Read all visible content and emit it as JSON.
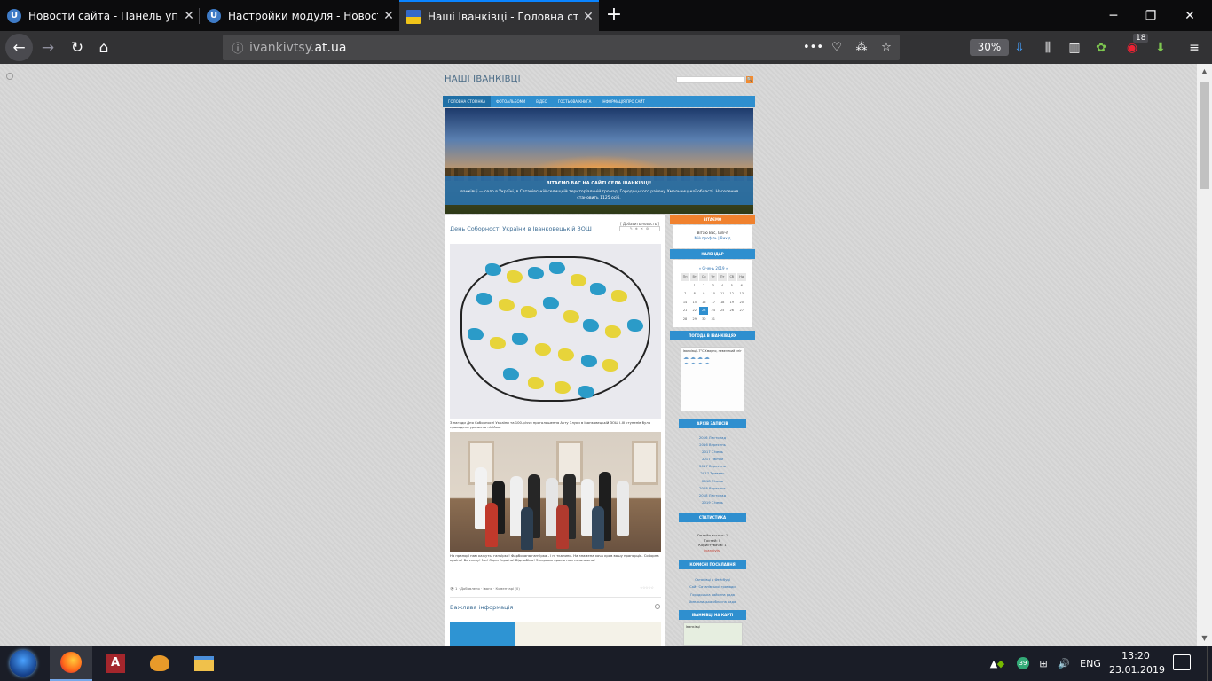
{
  "browser": {
    "tabs": [
      {
        "title": "Новости сайта - Панель упра",
        "favicon": "U"
      },
      {
        "title": "Настройки модуля - Новости",
        "favicon": "U"
      },
      {
        "title": "Наші Іванківці - Головна стор",
        "favicon": "flag-ua"
      }
    ],
    "url_host": "ivankivtsy.",
    "url_domain": "at.ua",
    "zoom": "30%",
    "badge_count": "18"
  },
  "site": {
    "title": "НАШІ ІВАНКІВЦІ",
    "nav": [
      "ГОЛОВНА СТОРІНКА",
      "ФОТОАЛЬБОМИ",
      "ВІДЕО",
      "ГОСТЬОВА КНИГА",
      "ІНФОРМАЦІЯ ПРО САЙТ"
    ],
    "hero_heading": "ВІТАЄМО ВАС НА САЙТІ СЕЛА ІВАНКІВЦІ!",
    "hero_text": "Іванківці — село в Україні, в Сатанівській селищній територіальній громаді Городоцького району Хмельницької області. Населення становить 1125 осіб."
  },
  "article": {
    "title": "День Соборності України в Іванковецькій ЗОШ",
    "tools_label": "[ Добавить новость ]",
    "caption1": "З нагоди Дня Соборності України та 100-річчя проголошення Акту Злуки в Іванковецькій ЗОШ І-ІІІ ступенів була проведена урочиста лінійка.",
    "caption2": "На прапорі нам кажуть, ганчірка! Фарбована ганчірка - і ні тканини. На знамена хоча кров вашу прапорців. Соборна країна! Во славу! Ми! Одна Україна! Відлюбімо! З перших кроків нам незалежна!",
    "meta": "👁 1  ·  Добавлено  ·  Іваня  ·  Коментарі (0)",
    "rating": "☆☆☆☆☆",
    "second_title": "Важлива інформація"
  },
  "sidebar": {
    "greeting_head": "ВІТАЄМО",
    "greeting_text": "Вітаю Вас, Ілліч!",
    "greeting_links": "Мій профіль | Вихід",
    "calendar_head": "КАЛЕНДАР",
    "calendar_title": "« Січень 2019 »",
    "weekdays": [
      "Пн",
      "Вт",
      "Ср",
      "Чт",
      "Пт",
      "Сб",
      "Нд"
    ],
    "weeks": [
      [
        "",
        "1",
        "2",
        "3",
        "4",
        "5",
        "6"
      ],
      [
        "7",
        "8",
        "9",
        "10",
        "11",
        "12",
        "13"
      ],
      [
        "14",
        "15",
        "16",
        "17",
        "18",
        "19",
        "20"
      ],
      [
        "21",
        "22",
        "23",
        "24",
        "25",
        "26",
        "27"
      ],
      [
        "28",
        "29",
        "30",
        "31",
        "",
        "",
        ""
      ]
    ],
    "today": "23",
    "weather_head": "ПОГОДА В ІВАНКІВЦЯХ",
    "weather_text": "Іванківці  -7°C  Хмарно, невеликий сніг",
    "archive_head": "АРХІВ ЗАПИСІВ",
    "archive": [
      "2016 Листопад",
      "2016 Вересень",
      "2017 Січень",
      "2017 Лютий",
      "2017 Вересень",
      "2017 Травень",
      "2018 Січень",
      "2018 Вересень",
      "2018 Листопад",
      "2019 Січень"
    ],
    "stats_head": "СТАТИСТИКА",
    "stats": [
      "Онлайн всього: 1",
      "Гостей: 0",
      "Користувачів: 1",
      "ivankivtsi"
    ],
    "links_head": "КОРИСНІ ПОСИЛАННЯ",
    "links": [
      "Сатанівці у Фейсбуці",
      "Сайт Сатанівської громади",
      "Городоцька районна рада",
      "Хмельницька обласна рада"
    ],
    "map_head": "ІВАНКІВЦІ НА КАРТІ",
    "map_text": "Іванківці"
  },
  "taskbar": {
    "lang": "ENG",
    "time": "13:20",
    "date": "23.01.2019",
    "tray_badge": "39"
  }
}
